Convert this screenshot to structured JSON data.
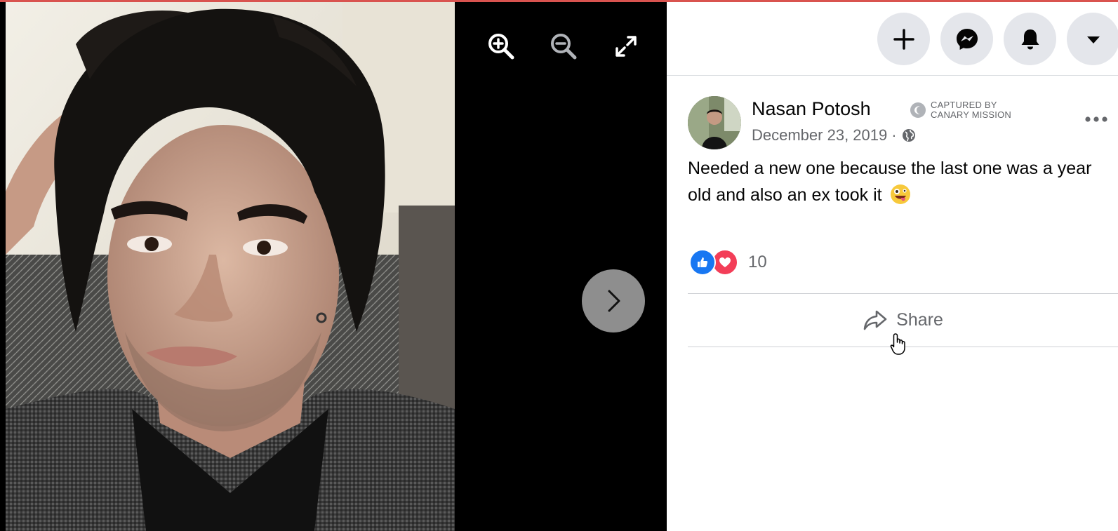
{
  "viewer": {
    "photo_alt": "Profile photo",
    "tools": {
      "zoom_in_icon": "zoom-in-icon",
      "zoom_out_icon": "zoom-out-icon",
      "fullscreen_icon": "expand-icon"
    },
    "next_icon": "chevron-right-icon"
  },
  "header": {
    "buttons": [
      {
        "name": "create",
        "icon": "plus-icon"
      },
      {
        "name": "messenger",
        "icon": "messenger-icon"
      },
      {
        "name": "notifications",
        "icon": "bell-icon"
      },
      {
        "name": "account",
        "icon": "caret-down-icon"
      }
    ]
  },
  "post": {
    "author": "Nasan Potosh",
    "badge": {
      "line1": "CAPTURED BY",
      "line2": "CANARY MISSION"
    },
    "date": "December 23, 2019",
    "separator": "·",
    "privacy_icon": "globe-icon",
    "text": "Needed a new one because the last one was a year old and also an ex took it",
    "emoji": "zany-face",
    "reactions": {
      "types": [
        "like",
        "love"
      ],
      "count": "10"
    },
    "share_label": "Share"
  },
  "colors": {
    "accent_stripe": "#d9534f",
    "like_blue": "#1877f2",
    "love_red": "#f33e58",
    "secondary_text": "#65676b",
    "button_gray": "#e4e6eb"
  }
}
